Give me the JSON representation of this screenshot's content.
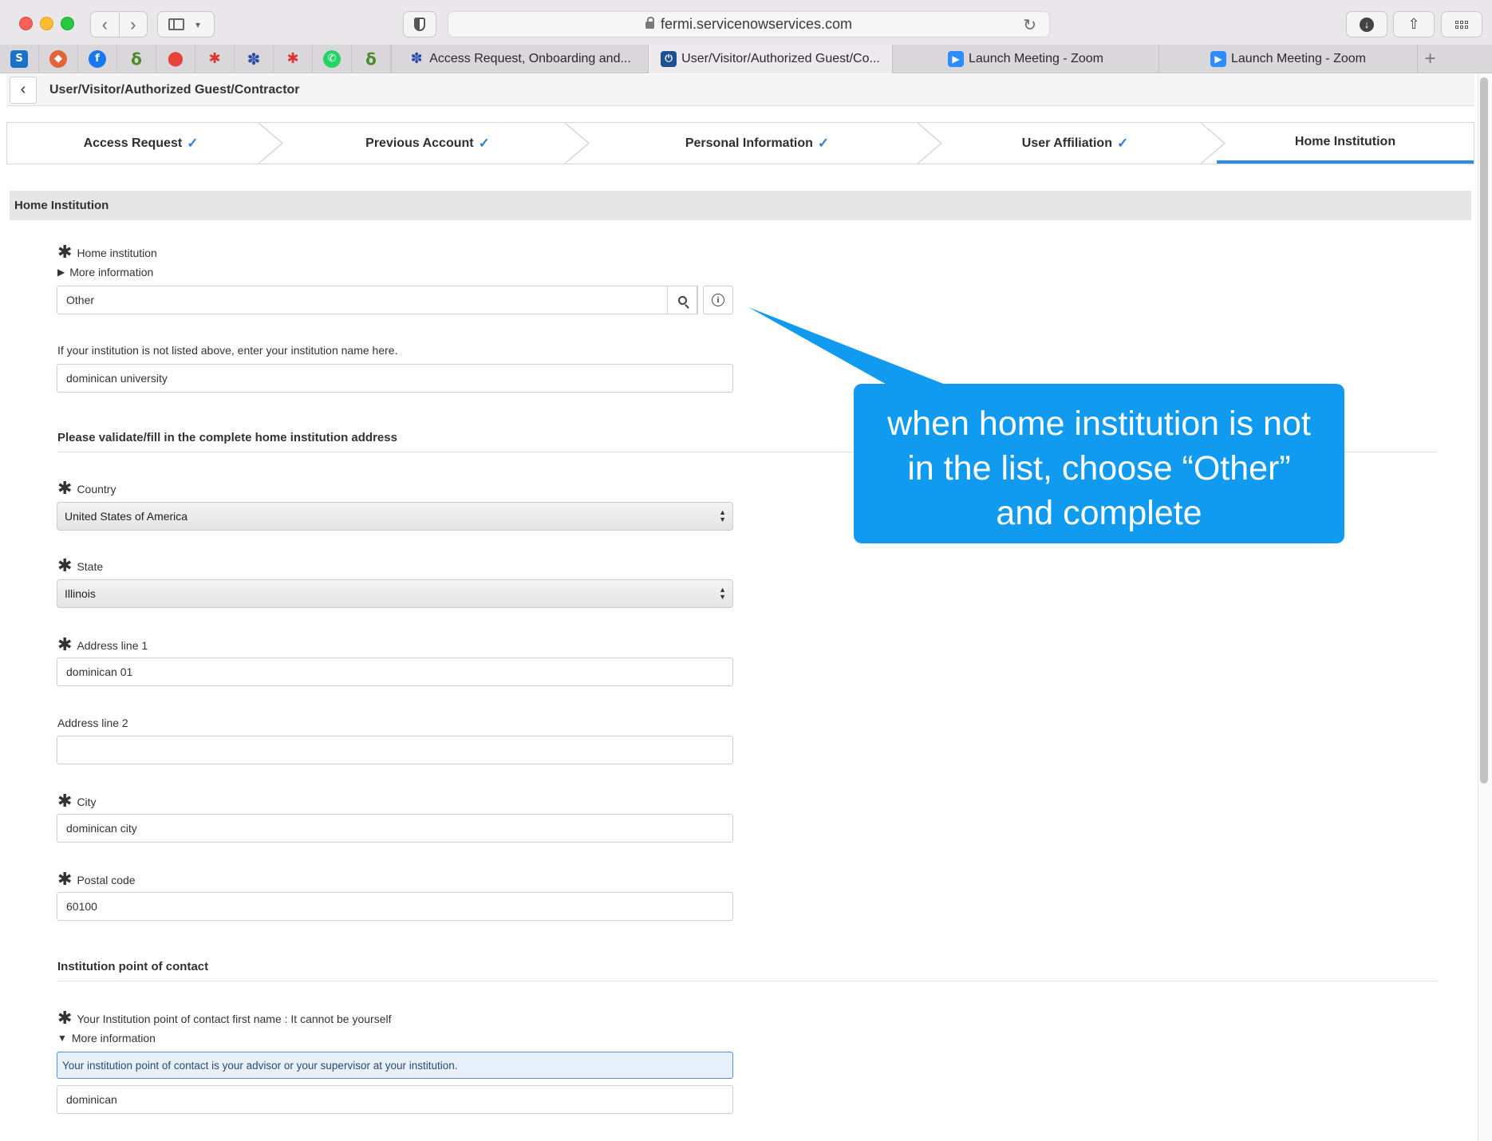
{
  "browser": {
    "url": "fermi.servicenowservices.com",
    "tabs": [
      {
        "label": "Access Request, Onboarding and...",
        "icon": "servicenow-icon",
        "active": false
      },
      {
        "label": "User/Visitor/Authorized Guest/Co...",
        "icon": "power-icon",
        "active": true
      },
      {
        "label": "Launch Meeting - Zoom",
        "icon": "zoom-icon",
        "active": false
      },
      {
        "label": "Launch Meeting - Zoom",
        "icon": "zoom-icon",
        "active": false
      }
    ],
    "pinned_icons": [
      "sharepoint-icon",
      "gitlab-icon",
      "facebook-icon",
      "sigma-icon",
      "maps-icon",
      "bug-icon",
      "servicenow-icon",
      "bug-icon",
      "whatsapp-icon",
      "sigma-icon"
    ]
  },
  "header": {
    "title": "User/Visitor/Authorized Guest/Contractor"
  },
  "stepper": {
    "steps": [
      {
        "label": "Access Request",
        "done": true
      },
      {
        "label": "Previous Account",
        "done": true
      },
      {
        "label": "Personal Information",
        "done": true
      },
      {
        "label": "User Affiliation",
        "done": true
      },
      {
        "label": "Home Institution",
        "done": false
      }
    ]
  },
  "form": {
    "section_title": "Home Institution",
    "home_institution": {
      "label": "Home institution",
      "more_info": "More information",
      "value": "Other"
    },
    "other_institution": {
      "label": "If your institution is not listed above, enter your institution name here.",
      "value": "dominican university"
    },
    "address_heading": "Please validate/fill in the complete home institution address",
    "country": {
      "label": "Country",
      "value": "United States of America"
    },
    "state": {
      "label": "State",
      "value": "Illinois"
    },
    "address1": {
      "label": "Address line 1",
      "value": "dominican 01"
    },
    "address2": {
      "label": "Address line 2",
      "value": ""
    },
    "city": {
      "label": "City",
      "value": "dominican city"
    },
    "postal": {
      "label": "Postal code",
      "value": "60100"
    },
    "contact_heading": "Institution point of contact",
    "contact_first": {
      "label": "Your Institution point of contact first name : It cannot be yourself",
      "more_info": "More information",
      "help": "Your institution point of contact is your advisor or your supervisor at your institution.",
      "value": "dominican"
    }
  },
  "callout": {
    "line1": "when home institution is not",
    "line2": "in the list, choose “Other”",
    "line3": "and complete"
  },
  "colors": {
    "callout": "#119bf0",
    "check": "#2d7fd0",
    "active_step_underline": "#2d8be0"
  }
}
